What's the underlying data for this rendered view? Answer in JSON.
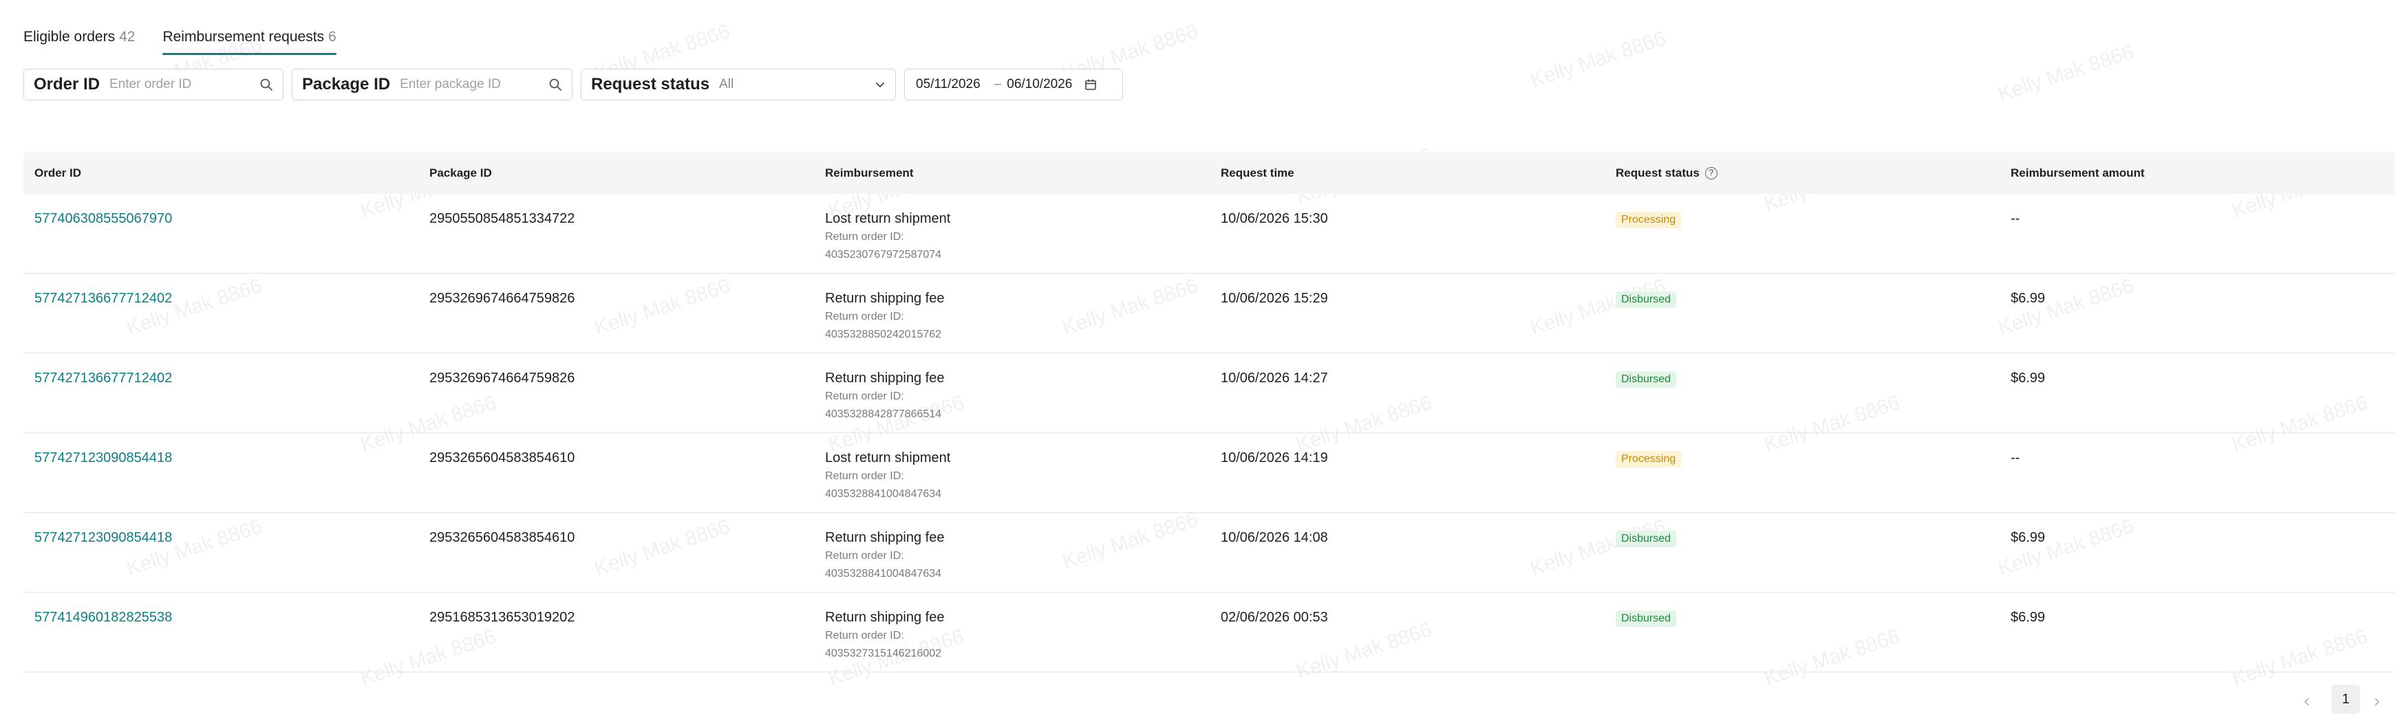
{
  "tabs": [
    {
      "label": "Eligible orders",
      "count": "42"
    },
    {
      "label": "Reimbursement requests",
      "count": "6"
    }
  ],
  "filters": {
    "order_id": {
      "label": "Order ID",
      "placeholder": "Enter order ID"
    },
    "package_id": {
      "label": "Package ID",
      "placeholder": "Enter package ID"
    },
    "request_status": {
      "label": "Request status",
      "value": "All"
    },
    "date_range": {
      "start": "05/11/2026",
      "separator": "–",
      "end": "06/10/2026"
    }
  },
  "table": {
    "columns": {
      "order_id": "Order ID",
      "package_id": "Package ID",
      "reimbursement": "Reimbursement",
      "request_time": "Request time",
      "request_status": "Request status",
      "amount": "Reimbursement amount"
    },
    "rows": [
      {
        "order_id": "577406308555067970",
        "package_id": "2950550854851334722",
        "type": "Lost return shipment",
        "return_label": "Return order ID:",
        "return_id": "4035230767972587074",
        "time": "10/06/2026 15:30",
        "status": "Processing",
        "amount": "--"
      },
      {
        "order_id": "577427136677712402",
        "package_id": "2953269674664759826",
        "type": "Return shipping fee",
        "return_label": "Return order ID:",
        "return_id": "4035328850242015762",
        "time": "10/06/2026 15:29",
        "status": "Disbursed",
        "amount": "$6.99"
      },
      {
        "order_id": "577427136677712402",
        "package_id": "2953269674664759826",
        "type": "Return shipping fee",
        "return_label": "Return order ID:",
        "return_id": "4035328842877866514",
        "time": "10/06/2026 14:27",
        "status": "Disbursed",
        "amount": "$6.99"
      },
      {
        "order_id": "577427123090854418",
        "package_id": "2953265604583854610",
        "type": "Lost return shipment",
        "return_label": "Return order ID:",
        "return_id": "4035328841004847634",
        "time": "10/06/2026 14:19",
        "status": "Processing",
        "amount": "--"
      },
      {
        "order_id": "577427123090854418",
        "package_id": "2953265604583854610",
        "type": "Return shipping fee",
        "return_label": "Return order ID:",
        "return_id": "4035328841004847634",
        "time": "10/06/2026 14:08",
        "status": "Disbursed",
        "amount": "$6.99"
      },
      {
        "order_id": "577414960182825538",
        "package_id": "2951685313653019202",
        "type": "Return shipping fee",
        "return_label": "Return order ID:",
        "return_id": "4035327315146216002",
        "time": "02/06/2026 00:53",
        "status": "Disbursed",
        "amount": "$6.99"
      }
    ]
  },
  "status_colors": {
    "Processing": {
      "bg": "#fff3d6",
      "fg": "#c98a00"
    },
    "Disbursed": {
      "bg": "#e3f5e8",
      "fg": "#1e8a3e"
    }
  },
  "accent_color": "#0d7d87",
  "pagination": {
    "current_page": "1"
  },
  "watermark": "Kelly Mak 8866"
}
